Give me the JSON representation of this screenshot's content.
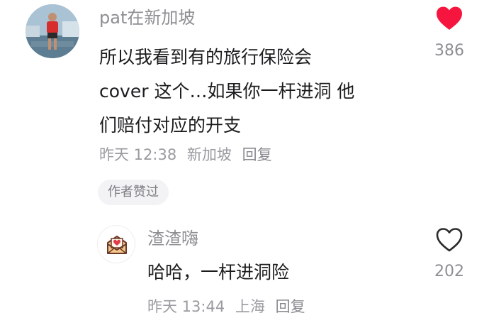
{
  "comment": {
    "username": "pat在新加坡",
    "text_lines": [
      "所以我看到有的旅行保险会",
      "cover 这个…如果你一杆进洞 他",
      "们赔付对应的开支"
    ],
    "time": "昨天 12:38",
    "location": "新加坡",
    "reply_label": "回复",
    "author_liked_label": "作者赞过",
    "like_count": "386",
    "liked": true,
    "liked_color": "#f5153e"
  },
  "reply": {
    "username": "渣渣嗨",
    "text": "哈哈，一杆进洞险",
    "time": "昨天 13:44",
    "location": "上海",
    "reply_label": "回复",
    "like_count": "202",
    "liked": false
  }
}
